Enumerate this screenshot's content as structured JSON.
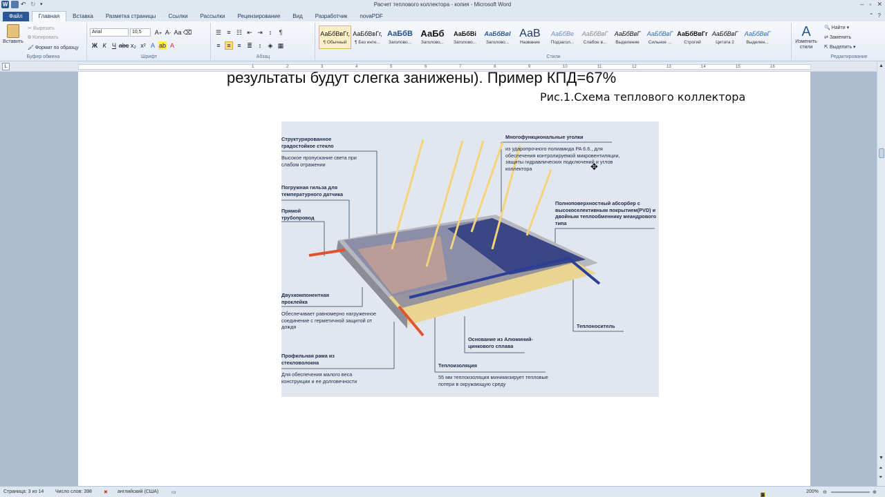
{
  "window": {
    "title": "Расчет теплового коллектора - копия - Microsoft Word"
  },
  "ribbon_tabs": [
    "Файл",
    "Главная",
    "Вставка",
    "Разметка страницы",
    "Ссылки",
    "Рассылки",
    "Рецензирование",
    "Вид",
    "Разработчик",
    "novaPDF"
  ],
  "clipboard": {
    "paste": "Вставить",
    "cut": "Вырезать",
    "copy": "Копировать",
    "format_painter": "Формат по образцу",
    "group": "Буфер обмена"
  },
  "font": {
    "name": "Arial",
    "size": "10,5",
    "group": "Шрифт"
  },
  "paragraph": {
    "group": "Абзац"
  },
  "styles": {
    "group": "Стили",
    "items": [
      {
        "sample": "АаБбВвГг,",
        "name": "¶ Обычный"
      },
      {
        "sample": "АаБбВвГг,",
        "name": "¶ Без инте..."
      },
      {
        "sample": "АаБбВ",
        "name": "Заголово..."
      },
      {
        "sample": "АаБб",
        "name": "Заголово..."
      },
      {
        "sample": "АаБбВі",
        "name": "Заголово..."
      },
      {
        "sample": "АаБбВвІ",
        "name": "Заголово..."
      },
      {
        "sample": "АаВ",
        "name": "Название"
      },
      {
        "sample": "АаБбВе",
        "name": "Подзагол..."
      },
      {
        "sample": "АаБбВвГ",
        "name": "Слабое в..."
      },
      {
        "sample": "АаБбВвГ",
        "name": "Выделение"
      },
      {
        "sample": "АаБбВвГ",
        "name": "Сильное ..."
      },
      {
        "sample": "АаБбВвГг",
        "name": "Строгий"
      },
      {
        "sample": "АаБбВвГ",
        "name": "Цитата 2"
      },
      {
        "sample": "АаБбВвГ",
        "name": "Выделен..."
      }
    ],
    "change_styles": "Изменить стили"
  },
  "editing": {
    "find": "Найти",
    "replace": "Заменить",
    "select": "Выделить",
    "group": "Редактирование"
  },
  "document": {
    "line_top": "результаты будут слегка занижены). Пример КПД=67%",
    "caption": "Рис.1.Схема теплового коллектора",
    "figure_labels": {
      "glass_title": "Структурированное градостойкое стекло",
      "glass_desc": "Высокое пропускание света при слабом отражении",
      "sleeve": "Погружная гильза для температурного датчика",
      "pipe": "Прямой трубопровод",
      "corners_title": "Многофункциональные уголки",
      "corners_desc": "из ударопрочного полиамида PA 6.6., для обеспечения контролируемой микровентиляции, защиты гидравлических подключений и углов коллектора",
      "absorber": "Полноповерхностный абсорбер с высокоселективным покрытием(PVD) и двойным теплообменнику меандрового типа",
      "glue_title": "Двухкомпонентная проклейка",
      "glue_desc": "Обеспечивает равномерно нагруженное соединение с герметичной защитой от дождя",
      "coolant": "Теплоноситель",
      "base": "Основание из Алюминий-цинкового сплава",
      "frame_title": "Профильная рама из стекловолокна",
      "frame_desc": "Для обеспечения малого веса конструкции и ее долговечности",
      "insulation_title": "Теплоизоляция",
      "insulation_desc": "55 мм теплоизоляция минимизирует тепловые потери в окружающую среду"
    }
  },
  "status": {
    "page": "Страница: 3 из 14",
    "words": "Число слов: 398",
    "language": "английский (США)",
    "zoom": "200%"
  },
  "colors": {
    "file_tab": "#2b5797",
    "arrow": "#f3d47a",
    "frame": "#b7b7bf",
    "insulation": "#e9d58f",
    "pipe_blue": "#2a3e9a",
    "pipe_red": "#e0532f"
  }
}
